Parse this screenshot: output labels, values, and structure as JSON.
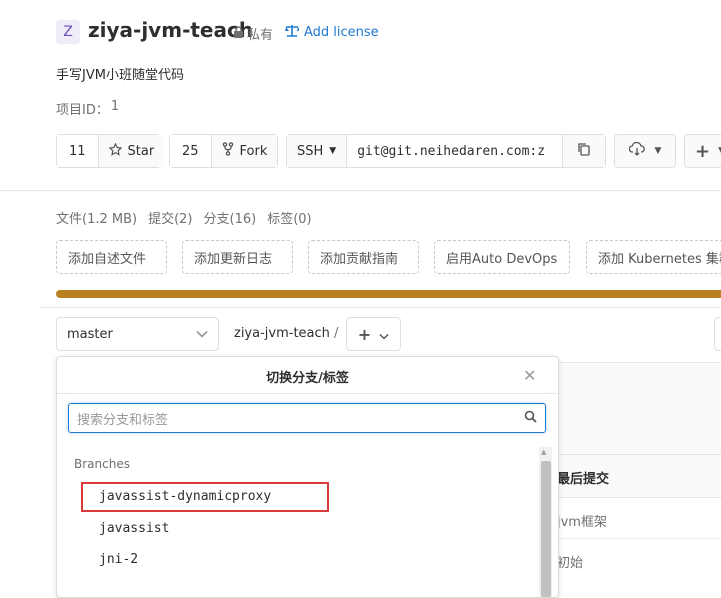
{
  "project": {
    "avatar_letter": "Z",
    "name": "ziya-jvm-teach",
    "visibility": "私有",
    "add_license": "Add license",
    "description": "手写JVM小班随堂代码",
    "id_label": "项目ID：",
    "id_value": "1"
  },
  "actions": {
    "star_count": "11",
    "star_label": "Star",
    "fork_count": "25",
    "fork_label": "Fork",
    "clone_protocol": "SSH",
    "clone_url": "git@git.neihedaren.com:z"
  },
  "stats": {
    "files": "文件(1.2 MB)",
    "commits": "提交(2)",
    "branches": "分支(16)",
    "tags": "标签(0)"
  },
  "suggestions": [
    "添加自述文件",
    "添加更新日志",
    "添加贡献指南",
    "启用Auto DevOps",
    "添加 Kubernetes 集群"
  ],
  "progress": {
    "fraction": 1.0,
    "color": "#b8801f"
  },
  "repo": {
    "branch": "master",
    "path": "ziya-jvm-teach",
    "separator": "/"
  },
  "dropdown": {
    "title": "切换分支/标签",
    "search_placeholder": "搜索分支和标签",
    "section": "Branches",
    "items": [
      "javassist-dynamicproxy",
      "javassist",
      "jni-2"
    ]
  },
  "table": {
    "header": "最后提交",
    "rows": [
      "jvm框架",
      "初始"
    ]
  },
  "colors": {
    "accent": "#1f78d1",
    "highlight": "#d93a3a"
  }
}
